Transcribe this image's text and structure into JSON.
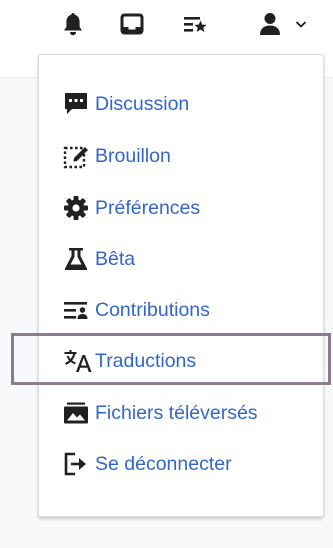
{
  "toolbar": {
    "icons": [
      {
        "name": "bell-icon"
      },
      {
        "name": "inbox-icon"
      },
      {
        "name": "watchlist-icon"
      },
      {
        "name": "user-icon"
      },
      {
        "name": "chevron-down-icon"
      }
    ]
  },
  "menu": {
    "items": [
      {
        "label": "Discussion",
        "icon": "talk-icon"
      },
      {
        "label": "Brouillon",
        "icon": "sandbox-icon"
      },
      {
        "label": "Préférences",
        "icon": "gear-icon"
      },
      {
        "label": "Bêta",
        "icon": "flask-icon"
      },
      {
        "label": "Contributions",
        "icon": "contributions-icon"
      },
      {
        "label": "Traductions",
        "icon": "translate-icon"
      },
      {
        "label": "Fichiers téléversés",
        "icon": "uploads-icon"
      },
      {
        "label": "Se déconnecter",
        "icon": "logout-icon"
      }
    ]
  },
  "colors": {
    "link": "#3366cc",
    "icon": "#202122",
    "highlight_border": "#8a7c93"
  }
}
